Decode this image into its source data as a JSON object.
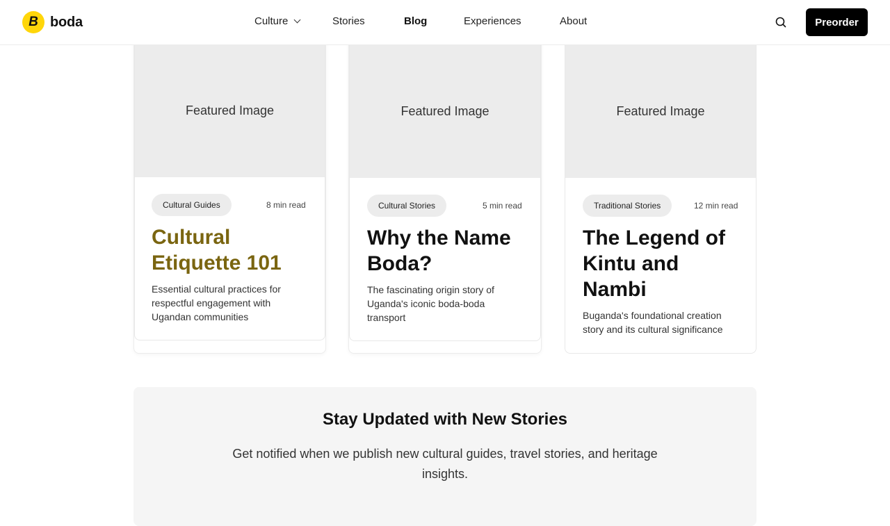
{
  "brand": {
    "logo_letter": "B",
    "name": "boda",
    "logo_color": "#ffd60a"
  },
  "nav": {
    "items": [
      {
        "label": "Culture",
        "has_dropdown": true,
        "active": false
      },
      {
        "label": "Stories",
        "has_dropdown": false,
        "active": false
      },
      {
        "label": "Blog",
        "has_dropdown": false,
        "active": true
      },
      {
        "label": "Experiences",
        "has_dropdown": false,
        "active": false
      },
      {
        "label": "About",
        "has_dropdown": false,
        "active": false
      }
    ],
    "search_icon": "search-icon",
    "preorder_label": "Preorder"
  },
  "cards": [
    {
      "image_label": "Featured Image",
      "category": "Cultural Guides",
      "read_time": "8 min read",
      "title_line1": "Cultural",
      "title_line2": "Etiquette 101",
      "title_line3": "",
      "desc_line1": "Essential cultural practices for",
      "desc_line2": "respectful engagement with",
      "desc_line3": "Ugandan communities",
      "title_color": "#7a6510"
    },
    {
      "image_label": "Featured Image",
      "category": "Cultural Stories",
      "read_time": "5 min read",
      "title_line1": "Why the Name",
      "title_line2": "Boda?",
      "title_line3": "",
      "desc_line1": "The fascinating origin story of",
      "desc_line2": "Uganda's iconic boda-boda",
      "desc_line3": "transport"
    },
    {
      "image_label": "Featured Image",
      "category": "Traditional Stories",
      "read_time": "12 min read",
      "title_line1": "The Legend of",
      "title_line2": "Kintu and",
      "title_line3": "Nambi",
      "desc_line1": "Buganda's foundational creation",
      "desc_line2": "story and its cultural significance",
      "desc_line3": ""
    }
  ],
  "newsletter": {
    "title": "Stay Updated with New Stories",
    "text": "Get notified when we publish new cultural guides, travel stories, and heritage insights."
  }
}
